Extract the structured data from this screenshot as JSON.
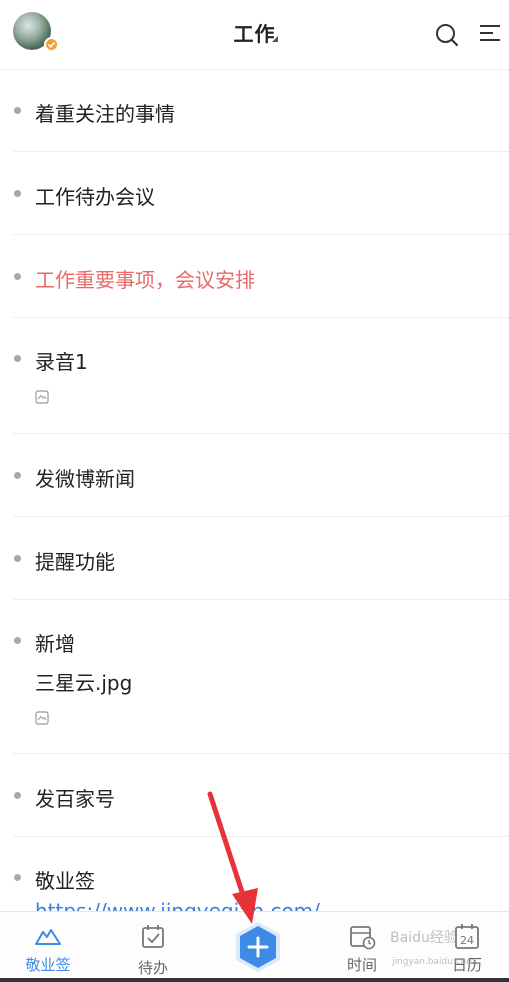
{
  "header": {
    "title": "工作",
    "avatar_icon": "user-avatar",
    "search_icon": "search-icon",
    "menu_icon": "menu-icon"
  },
  "list": {
    "items": [
      {
        "text": "着重关注的事情",
        "color": "#222222"
      },
      {
        "text": "工作待办会议",
        "color": "#222222"
      },
      {
        "text": "工作重要事项，会议安排",
        "color": "#e86a6a"
      },
      {
        "text": "录音1",
        "has_attachment": true
      },
      {
        "text": "发微博新闻"
      },
      {
        "text": "提醒功能"
      },
      {
        "text": "新增",
        "line2": "三星云.jpg",
        "has_attachment": true
      },
      {
        "text": "发百家号"
      },
      {
        "text": "敬业签",
        "link": "https://www.jingyeqian.com/"
      }
    ]
  },
  "bottom_bar": {
    "tabs": [
      {
        "label": "敬业签",
        "icon": "mountain-icon",
        "active": true
      },
      {
        "label": "待办",
        "icon": "checklist-icon",
        "active": false
      },
      {
        "label": "时间",
        "icon": "calendar-clock-icon",
        "active": false
      },
      {
        "label": "日历",
        "icon": "calendar-icon",
        "active": false,
        "day": "24"
      }
    ],
    "add_icon": "plus-icon"
  },
  "colors": {
    "accent": "#3d8be6",
    "highlight_text": "#e86a6a",
    "badge": "#f2a03a",
    "annotation_arrow": "#e8323a"
  },
  "watermark": {
    "text": "Baidu经验",
    "sub": "jingyan.baidu.com"
  }
}
